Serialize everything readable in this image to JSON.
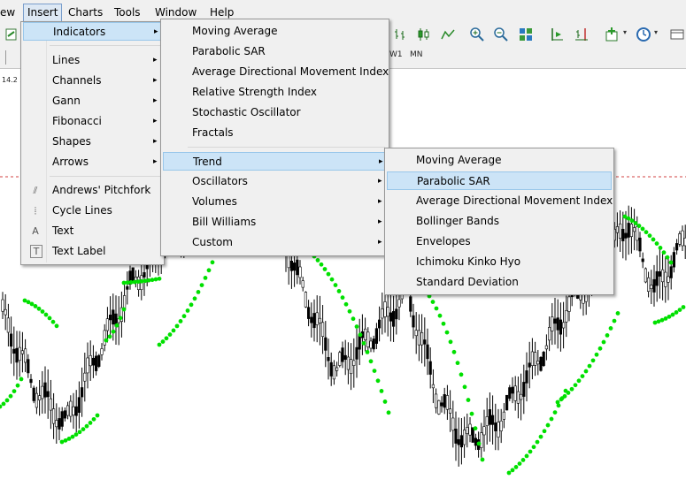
{
  "menubar": {
    "items": [
      {
        "label": "ew"
      },
      {
        "label": "Insert"
      },
      {
        "label": "Charts"
      },
      {
        "label": "Tools"
      },
      {
        "label": "Window"
      },
      {
        "label": "Help"
      }
    ]
  },
  "timeframes": {
    "w1": "W1",
    "mn": "MN"
  },
  "chart_label": "14.2 2",
  "insert_menu": {
    "items": [
      {
        "label": "Indicators",
        "arrow": "▸"
      },
      {
        "label": "Lines",
        "arrow": "▸"
      },
      {
        "label": "Channels",
        "arrow": "▸"
      },
      {
        "label": "Gann",
        "arrow": "▸"
      },
      {
        "label": "Fibonacci",
        "arrow": "▸"
      },
      {
        "label": "Shapes",
        "arrow": "▸"
      },
      {
        "label": "Arrows",
        "arrow": "▸"
      },
      {
        "label": "Andrews' Pitchfork",
        "icon": "pitchfork-icon",
        "glyph": "⫽"
      },
      {
        "label": "Cycle Lines",
        "icon": "cycle-lines-icon",
        "glyph": "⦙"
      },
      {
        "label": "Text",
        "icon": "text-icon",
        "glyph": "A"
      },
      {
        "label": "Text Label",
        "icon": "text-label-icon",
        "glyph": "T"
      }
    ]
  },
  "indicators_menu": {
    "items": [
      {
        "label": "Moving Average"
      },
      {
        "label": "Parabolic SAR"
      },
      {
        "label": "Average Directional Movement Index"
      },
      {
        "label": "Relative Strength Index"
      },
      {
        "label": "Stochastic Oscillator"
      },
      {
        "label": "Fractals"
      },
      {
        "label": "Trend",
        "arrow": "▸"
      },
      {
        "label": "Oscillators",
        "arrow": "▸"
      },
      {
        "label": "Volumes",
        "arrow": "▸"
      },
      {
        "label": "Bill Williams",
        "arrow": "▸"
      },
      {
        "label": "Custom",
        "arrow": "▸"
      }
    ]
  },
  "trend_menu": {
    "items": [
      {
        "label": "Moving Average"
      },
      {
        "label": "Parabolic SAR"
      },
      {
        "label": "Average Directional Movement Index"
      },
      {
        "label": "Bollinger Bands"
      },
      {
        "label": "Envelopes"
      },
      {
        "label": "Ichimoku Kinko Hyo"
      },
      {
        "label": "Standard Deviation"
      }
    ]
  },
  "colors": {
    "highlight": "#cce4f7",
    "sar_dots": "#00e000",
    "candles": "#000000",
    "level_line": "#d04040"
  }
}
